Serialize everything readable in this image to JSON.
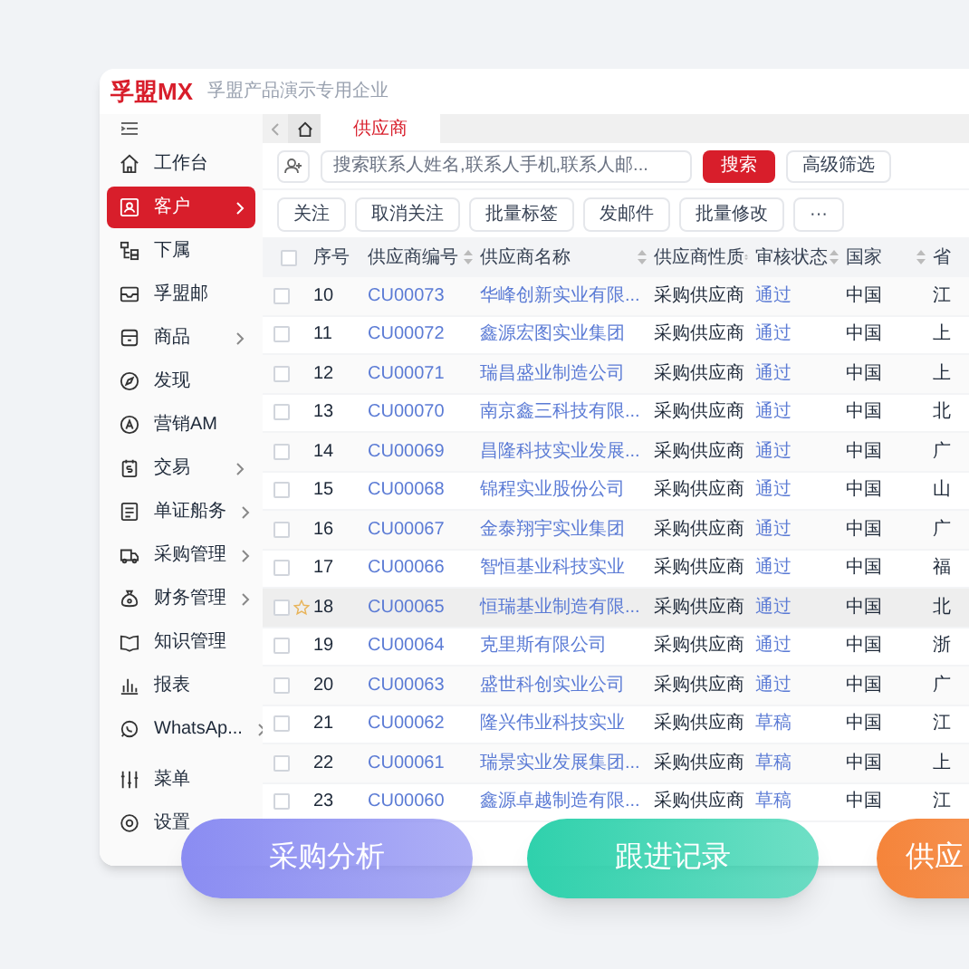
{
  "header": {
    "logo": "孚盟MX",
    "subtitle": "孚盟产品演示专用企业"
  },
  "sidebar": {
    "items": [
      {
        "label": "工作台",
        "selected": false,
        "has_submenu": false
      },
      {
        "label": "客户",
        "selected": true,
        "has_submenu": true
      },
      {
        "label": "下属",
        "selected": false,
        "has_submenu": false
      },
      {
        "label": "孚盟邮",
        "selected": false,
        "has_submenu": false
      },
      {
        "label": "商品",
        "selected": false,
        "has_submenu": true
      },
      {
        "label": "发现",
        "selected": false,
        "has_submenu": false
      },
      {
        "label": "营销AM",
        "selected": false,
        "has_submenu": false
      },
      {
        "label": "交易",
        "selected": false,
        "has_submenu": true
      },
      {
        "label": "单证船务",
        "selected": false,
        "has_submenu": true
      },
      {
        "label": "采购管理",
        "selected": false,
        "has_submenu": true
      },
      {
        "label": "财务管理",
        "selected": false,
        "has_submenu": true
      },
      {
        "label": "知识管理",
        "selected": false,
        "has_submenu": false
      },
      {
        "label": "报表",
        "selected": false,
        "has_submenu": false
      },
      {
        "label": "WhatsAp...",
        "selected": false,
        "has_submenu": true
      },
      {
        "label": "菜单",
        "selected": false,
        "has_submenu": false
      },
      {
        "label": "设置",
        "selected": false,
        "has_submenu": false
      }
    ]
  },
  "tabs": [
    {
      "label": "供应商",
      "selected": true
    }
  ],
  "search": {
    "placeholder": "搜索联系人姓名,联系人手机,联系人邮...",
    "button": "搜索",
    "advanced": "高级筛选"
  },
  "actions": [
    "关注",
    "取消关注",
    "批量标签",
    "发邮件",
    "批量修改",
    "···"
  ],
  "table": {
    "select_all_checked": false,
    "columns": [
      {
        "label": "序号",
        "sortable": false
      },
      {
        "label": "供应商编号",
        "sortable": true
      },
      {
        "label": "供应商名称",
        "sortable": true
      },
      {
        "label": "供应商性质",
        "sortable": true
      },
      {
        "label": "审核状态",
        "sortable": true
      },
      {
        "label": "国家",
        "sortable": true
      },
      {
        "label": "省",
        "sortable": false
      }
    ],
    "rows": [
      {
        "cells": [
          "10",
          "CU00073",
          "华峰创新实业有限...",
          "采购供应商",
          "通过",
          "中国",
          "江"
        ],
        "starred": false,
        "highlighted": false
      },
      {
        "cells": [
          "11",
          "CU00072",
          "鑫源宏图实业集团",
          "采购供应商",
          "通过",
          "中国",
          "上"
        ],
        "starred": false,
        "highlighted": false
      },
      {
        "cells": [
          "12",
          "CU00071",
          "瑞昌盛业制造公司",
          "采购供应商",
          "通过",
          "中国",
          "上"
        ],
        "starred": false,
        "highlighted": false
      },
      {
        "cells": [
          "13",
          "CU00070",
          "南京鑫三科技有限...",
          "采购供应商",
          "通过",
          "中国",
          "北"
        ],
        "starred": false,
        "highlighted": false
      },
      {
        "cells": [
          "14",
          "CU00069",
          "昌隆科技实业发展...",
          "采购供应商",
          "通过",
          "中国",
          "广"
        ],
        "starred": false,
        "highlighted": false
      },
      {
        "cells": [
          "15",
          "CU00068",
          "锦程实业股份公司",
          "采购供应商",
          "通过",
          "中国",
          "山"
        ],
        "starred": false,
        "highlighted": false
      },
      {
        "cells": [
          "16",
          "CU00067",
          "金泰翔宇实业集团",
          "采购供应商",
          "通过",
          "中国",
          "广"
        ],
        "starred": false,
        "highlighted": false
      },
      {
        "cells": [
          "17",
          "CU00066",
          "智恒基业科技实业",
          "采购供应商",
          "通过",
          "中国",
          "福"
        ],
        "starred": false,
        "highlighted": false
      },
      {
        "cells": [
          "18",
          "CU00065",
          "恒瑞基业制造有限...",
          "采购供应商",
          "通过",
          "中国",
          "北"
        ],
        "starred": true,
        "highlighted": true
      },
      {
        "cells": [
          "19",
          "CU00064",
          "克里斯有限公司",
          "采购供应商",
          "通过",
          "中国",
          "浙"
        ],
        "starred": false,
        "highlighted": false
      },
      {
        "cells": [
          "20",
          "CU00063",
          "盛世科创实业公司",
          "采购供应商",
          "通过",
          "中国",
          "广"
        ],
        "starred": false,
        "highlighted": false
      },
      {
        "cells": [
          "21",
          "CU00062",
          "隆兴伟业科技实业",
          "采购供应商",
          "草稿",
          "中国",
          "江"
        ],
        "starred": false,
        "highlighted": false
      },
      {
        "cells": [
          "22",
          "CU00061",
          "瑞景实业发展集团...",
          "采购供应商",
          "草稿",
          "中国",
          "上"
        ],
        "starred": false,
        "highlighted": false
      },
      {
        "cells": [
          "23",
          "CU00060",
          "鑫源卓越制造有限...",
          "采购供应商",
          "草稿",
          "中国",
          "江"
        ],
        "starred": false,
        "highlighted": false
      }
    ]
  },
  "feature_pills": [
    {
      "label": "采购分析",
      "color": "#8a8cf2"
    },
    {
      "label": "跟进记录",
      "color": "#2fd1ac"
    },
    {
      "label": "供应",
      "color": "#f5843a"
    }
  ]
}
